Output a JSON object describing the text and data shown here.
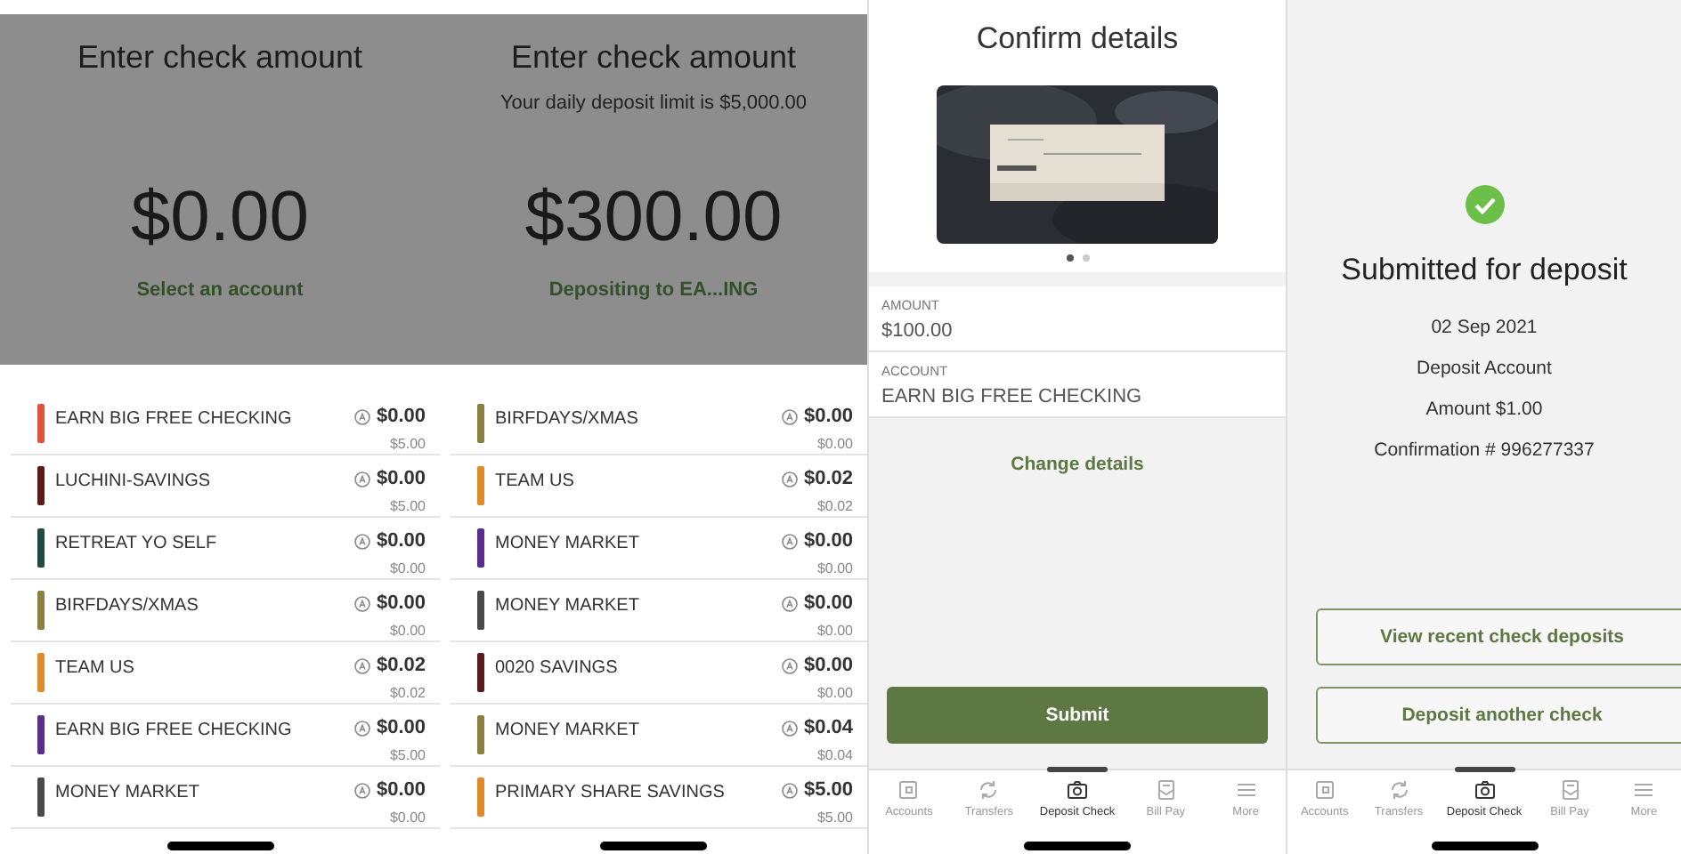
{
  "screens": [
    {
      "kind": "amount",
      "title": "Enter check amount",
      "amount": "$0.00",
      "link": "Select an account",
      "accounts": [
        {
          "name": "EARN BIG FREE CHECKING",
          "color": "#e0533a",
          "balance": "$0.00",
          "available": "$5.00"
        },
        {
          "name": "LUCHINI-SAVINGS",
          "color": "#5a1a1a",
          "balance": "$0.00",
          "available": "$5.00"
        },
        {
          "name": "RETREAT YO SELF",
          "color": "#1f4a40",
          "balance": "$0.00",
          "available": "$0.00"
        },
        {
          "name": "BIRFDAYS/XMAS",
          "color": "#8a8040",
          "balance": "$0.00",
          "available": "$0.00"
        },
        {
          "name": "TEAM US",
          "color": "#e08a2a",
          "balance": "$0.02",
          "available": "$0.02"
        },
        {
          "name": "EARN BIG FREE CHECKING",
          "color": "#5a2d8a",
          "balance": "$0.00",
          "available": "$5.00"
        },
        {
          "name": "MONEY MARKET",
          "color": "#4a4a4a",
          "balance": "$0.00",
          "available": "$0.00"
        }
      ]
    },
    {
      "kind": "amount",
      "title": "Enter check amount",
      "subtitle": "Your daily deposit limit is $5,000.00",
      "amount": "$300.00",
      "link": "Depositing to EA...ING",
      "accounts": [
        {
          "name": "BIRFDAYS/XMAS",
          "color": "#8a8040",
          "balance": "$0.00",
          "available": "$0.00"
        },
        {
          "name": "TEAM US",
          "color": "#e08a2a",
          "balance": "$0.02",
          "available": "$0.02"
        },
        {
          "name": "MONEY MARKET",
          "color": "#5a2d8a",
          "balance": "$0.00",
          "available": "$0.00"
        },
        {
          "name": "MONEY MARKET",
          "color": "#4a4a4a",
          "balance": "$0.00",
          "available": "$0.00"
        },
        {
          "name": "0020 SAVINGS",
          "color": "#5a1a1a",
          "balance": "$0.00",
          "available": "$0.00"
        },
        {
          "name": "MONEY MARKET",
          "color": "#8a8040",
          "balance": "$0.04",
          "available": "$0.04"
        },
        {
          "name": "PRIMARY SHARE SAVINGS",
          "color": "#e08a2a",
          "balance": "$5.00",
          "available": "$5.00"
        }
      ]
    },
    {
      "kind": "confirm",
      "title": "Confirm details",
      "pages": [
        {
          "selected": true
        },
        {
          "selected": false
        }
      ],
      "fields": [
        {
          "label": "AMOUNT",
          "value": "$100.00"
        },
        {
          "label": "ACCOUNT",
          "value": "EARN BIG FREE CHECKING"
        }
      ],
      "link": "Change details",
      "button": "Submit",
      "tabs": [
        {
          "label": "Accounts",
          "selected": false
        },
        {
          "label": "Transfers",
          "selected": false
        },
        {
          "label": "Deposit Check",
          "selected": true
        },
        {
          "label": "Bill Pay",
          "selected": false
        },
        {
          "label": "More",
          "selected": false
        }
      ]
    },
    {
      "kind": "done",
      "title": "Submitted for deposit",
      "lines": [
        "02 Sep 2021",
        "Deposit Account",
        "Amount $1.00",
        "Confirmation # 996277337"
      ],
      "buttons": [
        "View recent check deposits",
        "Deposit another check"
      ],
      "tabs": [
        {
          "label": "Accounts",
          "selected": false
        },
        {
          "label": "Transfers",
          "selected": false
        },
        {
          "label": "Deposit Check",
          "selected": true
        },
        {
          "label": "Bill Pay",
          "selected": false
        },
        {
          "label": "More",
          "selected": false
        }
      ]
    }
  ]
}
